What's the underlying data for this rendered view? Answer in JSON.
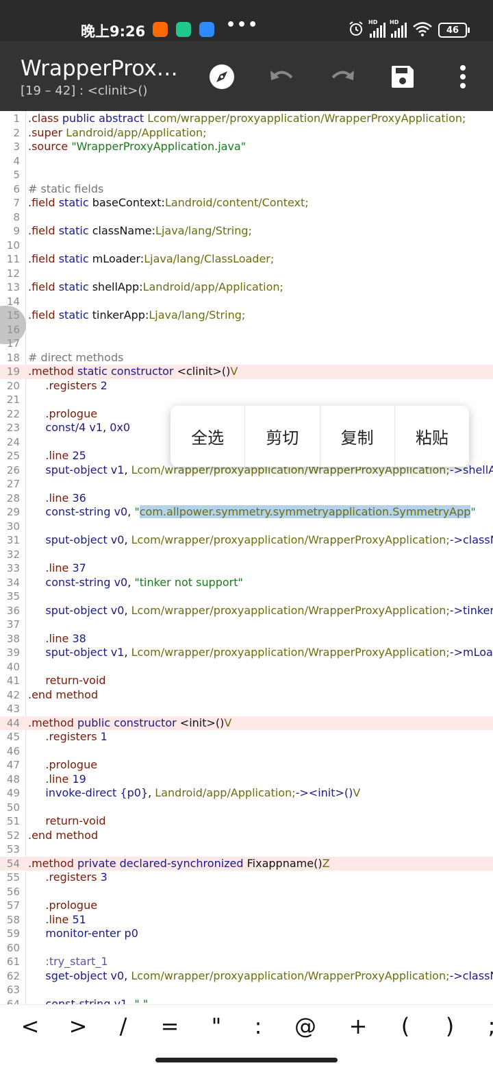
{
  "status_bar": {
    "time": "晚上9:26",
    "signal1_label": "HD",
    "signal2_label": "HD",
    "battery": "46",
    "app_colors": [
      "#ff6a00",
      "#1ec98b",
      "#2e8bff"
    ]
  },
  "toolbar": {
    "title": "WrapperProxyApplication",
    "subtitle": "[19 – 42] : <clinit>()",
    "icons": [
      "compass-icon",
      "undo-icon",
      "redo-icon",
      "save-icon",
      "more-icon"
    ]
  },
  "editor": {
    "lines": [
      {
        "n": "1",
        "hl": false,
        "t": [
          [
            ".class ",
            "kw"
          ],
          [
            "public abstract ",
            "acc"
          ],
          [
            "Lcom/wrapper/proxyapplication/WrapperProxyApplication;",
            "type"
          ]
        ]
      },
      {
        "n": "2",
        "hl": false,
        "t": [
          [
            ".super ",
            "kw"
          ],
          [
            "Landroid/app/Application;",
            "type"
          ]
        ]
      },
      {
        "n": "3",
        "hl": false,
        "t": [
          [
            ".source ",
            "kw"
          ],
          [
            "\"WrapperProxyApplication.java\"",
            "str"
          ]
        ]
      },
      {
        "n": "4",
        "hl": false,
        "t": []
      },
      {
        "n": "5",
        "hl": false,
        "t": []
      },
      {
        "n": "6",
        "hl": false,
        "t": [
          [
            "# static fields",
            "cmt"
          ]
        ]
      },
      {
        "n": "7",
        "hl": false,
        "t": [
          [
            ".field ",
            "kw"
          ],
          [
            "static ",
            "acc"
          ],
          [
            "baseContext:",
            "plain"
          ],
          [
            "Landroid/content/Context;",
            "type"
          ]
        ]
      },
      {
        "n": "8",
        "hl": false,
        "t": []
      },
      {
        "n": "9",
        "hl": false,
        "t": [
          [
            ".field ",
            "kw"
          ],
          [
            "static ",
            "acc"
          ],
          [
            "className:",
            "plain"
          ],
          [
            "Ljava/lang/String;",
            "type"
          ]
        ]
      },
      {
        "n": "10",
        "hl": false,
        "t": []
      },
      {
        "n": "11",
        "hl": false,
        "t": [
          [
            ".field ",
            "kw"
          ],
          [
            "static ",
            "acc"
          ],
          [
            "mLoader:",
            "plain"
          ],
          [
            "Ljava/lang/ClassLoader;",
            "type"
          ]
        ]
      },
      {
        "n": "12",
        "hl": false,
        "t": []
      },
      {
        "n": "13",
        "hl": false,
        "t": [
          [
            ".field ",
            "kw"
          ],
          [
            "static ",
            "acc"
          ],
          [
            "shellApp:",
            "plain"
          ],
          [
            "Landroid/app/Application;",
            "type"
          ]
        ]
      },
      {
        "n": "14",
        "hl": false,
        "t": []
      },
      {
        "n": "15",
        "hl": false,
        "t": [
          [
            ".field ",
            "kw"
          ],
          [
            "static ",
            "acc"
          ],
          [
            "tinkerApp:",
            "plain"
          ],
          [
            "Ljava/lang/String;",
            "type"
          ]
        ]
      },
      {
        "n": "16",
        "hl": false,
        "t": []
      },
      {
        "n": "17",
        "hl": false,
        "t": []
      },
      {
        "n": "18",
        "hl": false,
        "t": [
          [
            "# direct methods",
            "cmt"
          ]
        ]
      },
      {
        "n": "19",
        "hl": true,
        "t": [
          [
            ".method ",
            "kw"
          ],
          [
            "static constructor ",
            "acc"
          ],
          [
            "<clinit>()",
            "plain"
          ],
          [
            "V",
            "type"
          ]
        ]
      },
      {
        "n": "20",
        "hl": false,
        "t": [
          [
            "     .registers ",
            "kw"
          ],
          [
            "2",
            "num"
          ]
        ]
      },
      {
        "n": "21",
        "hl": false,
        "t": []
      },
      {
        "n": "22",
        "hl": false,
        "t": [
          [
            "     .prologue",
            "kw"
          ]
        ]
      },
      {
        "n": "23",
        "hl": false,
        "t": [
          [
            "     const/4 ",
            "acc"
          ],
          [
            "v1",
            "acc"
          ],
          [
            ", ",
            "plain"
          ],
          [
            "0x0",
            "num"
          ]
        ]
      },
      {
        "n": "24",
        "hl": false,
        "t": []
      },
      {
        "n": "25",
        "hl": false,
        "t": [
          [
            "     .line ",
            "kw"
          ],
          [
            "25",
            "num"
          ]
        ]
      },
      {
        "n": "26",
        "hl": false,
        "t": [
          [
            "     sput-object ",
            "acc"
          ],
          [
            "v1",
            "acc"
          ],
          [
            ", ",
            "plain"
          ],
          [
            "Lcom/wrapper/proxyapplication/WrapperProxyApplication;",
            "type"
          ],
          [
            "->shellApp",
            "acc"
          ]
        ]
      },
      {
        "n": "27",
        "hl": false,
        "t": []
      },
      {
        "n": "28",
        "hl": false,
        "t": [
          [
            "     .line ",
            "kw"
          ],
          [
            "36",
            "num"
          ]
        ]
      },
      {
        "n": "29",
        "hl": false,
        "t": [
          [
            "     const-string ",
            "acc"
          ],
          [
            "v0",
            "acc"
          ],
          [
            ", ",
            "plain"
          ],
          [
            "\"",
            "str"
          ],
          [
            "com.allpower.symmetry.symmetryapplication.SymmetryApp",
            "sel"
          ],
          [
            "\"",
            "str"
          ]
        ]
      },
      {
        "n": "30",
        "hl": false,
        "t": []
      },
      {
        "n": "31",
        "hl": false,
        "t": [
          [
            "     sput-object ",
            "acc"
          ],
          [
            "v0",
            "acc"
          ],
          [
            ", ",
            "plain"
          ],
          [
            "Lcom/wrapper/proxyapplication/WrapperProxyApplication;",
            "type"
          ],
          [
            "->className",
            "acc"
          ]
        ]
      },
      {
        "n": "32",
        "hl": false,
        "t": []
      },
      {
        "n": "33",
        "hl": false,
        "t": [
          [
            "     .line ",
            "kw"
          ],
          [
            "37",
            "num"
          ]
        ]
      },
      {
        "n": "34",
        "hl": false,
        "t": [
          [
            "     const-string ",
            "acc"
          ],
          [
            "v0",
            "acc"
          ],
          [
            ", ",
            "plain"
          ],
          [
            "\"tinker not support\"",
            "str"
          ]
        ]
      },
      {
        "n": "35",
        "hl": false,
        "t": []
      },
      {
        "n": "36",
        "hl": false,
        "t": [
          [
            "     sput-object ",
            "acc"
          ],
          [
            "v0",
            "acc"
          ],
          [
            ", ",
            "plain"
          ],
          [
            "Lcom/wrapper/proxyapplication/WrapperProxyApplication;",
            "type"
          ],
          [
            "->tinkerApp",
            "acc"
          ]
        ]
      },
      {
        "n": "37",
        "hl": false,
        "t": []
      },
      {
        "n": "38",
        "hl": false,
        "t": [
          [
            "     .line ",
            "kw"
          ],
          [
            "38",
            "num"
          ]
        ]
      },
      {
        "n": "39",
        "hl": false,
        "t": [
          [
            "     sput-object ",
            "acc"
          ],
          [
            "v1",
            "acc"
          ],
          [
            ", ",
            "plain"
          ],
          [
            "Lcom/wrapper/proxyapplication/WrapperProxyApplication;",
            "type"
          ],
          [
            "->mLoader",
            "acc"
          ]
        ]
      },
      {
        "n": "40",
        "hl": false,
        "t": []
      },
      {
        "n": "41",
        "hl": false,
        "t": [
          [
            "     return-void",
            "kw"
          ]
        ]
      },
      {
        "n": "42",
        "hl": false,
        "t": [
          [
            ".end method",
            "kw"
          ]
        ]
      },
      {
        "n": "43",
        "hl": false,
        "t": []
      },
      {
        "n": "44",
        "hl": true,
        "t": [
          [
            ".method ",
            "kw"
          ],
          [
            "public constructor ",
            "acc"
          ],
          [
            "<init>()",
            "plain"
          ],
          [
            "V",
            "type"
          ]
        ]
      },
      {
        "n": "45",
        "hl": false,
        "t": [
          [
            "     .registers ",
            "kw"
          ],
          [
            "1",
            "num"
          ]
        ]
      },
      {
        "n": "46",
        "hl": false,
        "t": []
      },
      {
        "n": "47",
        "hl": false,
        "t": [
          [
            "     .prologue",
            "kw"
          ]
        ]
      },
      {
        "n": "48",
        "hl": false,
        "t": [
          [
            "     .line ",
            "kw"
          ],
          [
            "19",
            "num"
          ]
        ]
      },
      {
        "n": "49",
        "hl": false,
        "t": [
          [
            "     invoke-direct ",
            "acc"
          ],
          [
            "{p0}",
            "acc"
          ],
          [
            ", ",
            "plain"
          ],
          [
            "Landroid/app/Application;",
            "type"
          ],
          [
            "-><init>()",
            "acc"
          ],
          [
            "V",
            "type"
          ]
        ]
      },
      {
        "n": "50",
        "hl": false,
        "t": []
      },
      {
        "n": "51",
        "hl": false,
        "t": [
          [
            "     return-void",
            "kw"
          ]
        ]
      },
      {
        "n": "52",
        "hl": false,
        "t": [
          [
            ".end method",
            "kw"
          ]
        ]
      },
      {
        "n": "53",
        "hl": false,
        "t": []
      },
      {
        "n": "54",
        "hl": true,
        "t": [
          [
            ".method ",
            "kw"
          ],
          [
            "private declared-synchronized ",
            "acc"
          ],
          [
            "Fixappname()",
            "plain"
          ],
          [
            "Z",
            "type"
          ]
        ]
      },
      {
        "n": "55",
        "hl": false,
        "t": [
          [
            "     .registers ",
            "kw"
          ],
          [
            "3",
            "num"
          ]
        ]
      },
      {
        "n": "56",
        "hl": false,
        "t": []
      },
      {
        "n": "57",
        "hl": false,
        "t": [
          [
            "     .prologue",
            "kw"
          ]
        ]
      },
      {
        "n": "58",
        "hl": false,
        "t": [
          [
            "     .line ",
            "kw"
          ],
          [
            "51",
            "num"
          ]
        ]
      },
      {
        "n": "59",
        "hl": false,
        "t": [
          [
            "     monitor-enter ",
            "acc"
          ],
          [
            "p0",
            "acc"
          ]
        ]
      },
      {
        "n": "60",
        "hl": false,
        "t": []
      },
      {
        "n": "61",
        "hl": false,
        "t": [
          [
            "     :try_start_1",
            "lbl"
          ]
        ]
      },
      {
        "n": "62",
        "hl": false,
        "t": [
          [
            "     sget-object ",
            "acc"
          ],
          [
            "v0",
            "acc"
          ],
          [
            ", ",
            "plain"
          ],
          [
            "Lcom/wrapper/proxyapplication/WrapperProxyApplication;",
            "type"
          ],
          [
            "->className",
            "acc"
          ]
        ]
      },
      {
        "n": "63",
        "hl": false,
        "t": []
      },
      {
        "n": "64",
        "hl": false,
        "t": [
          [
            "     const-string ",
            "acc"
          ],
          [
            "v1",
            "acc"
          ],
          [
            ", ",
            "plain"
          ],
          [
            "\".\"",
            "str"
          ]
        ]
      }
    ]
  },
  "context_menu": {
    "items": [
      "全选",
      "剪切",
      "复制",
      "粘贴"
    ]
  },
  "symbol_bar": {
    "symbols": [
      "<",
      ">",
      "/",
      "=",
      "\"",
      ":",
      "@",
      "+",
      "(",
      ")",
      ";"
    ]
  }
}
